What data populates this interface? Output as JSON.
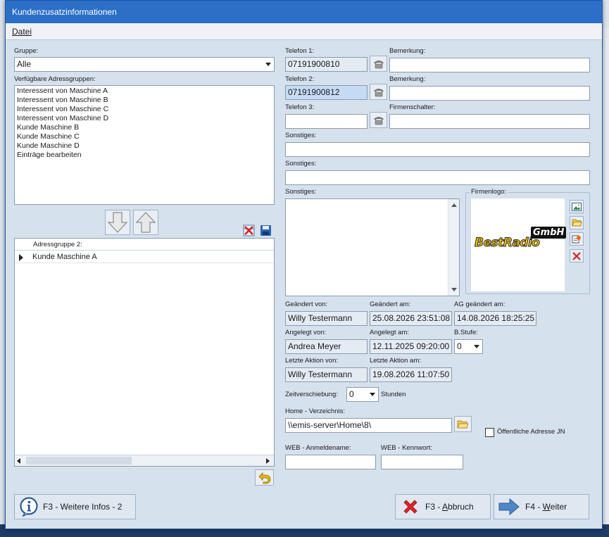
{
  "window": {
    "title": "Kundenzusatzinformationen"
  },
  "menu": {
    "datei": "Datei"
  },
  "left": {
    "gruppe_label": "Gruppe:",
    "gruppe_value": "Alle",
    "verfuegbar_label": "Verfügbare Adressgruppen:",
    "groups": [
      "Interessent von Maschine A",
      "Interessent von Maschine B",
      "Interessent von Maschine C",
      "Interessent von Maschine D",
      "Kunde Maschine B",
      "Kunde Maschine C",
      "Kunde Maschine D",
      "Einträge bearbeiten"
    ],
    "grid_header": "Adressgruppe 2:",
    "grid_rows": [
      "Kunde Maschine A"
    ]
  },
  "right": {
    "telefon1_label": "Telefon 1:",
    "telefon1_value": "07191900810",
    "telefon2_label": "Telefon 2:",
    "telefon2_value": "07191900812",
    "telefon3_label": "Telefon 3:",
    "telefon3_value": "",
    "bemerkung1_label": "Bemerkung:",
    "bemerkung2_label": "Bemerkung:",
    "firmenschalter_label": "Firmenschalter:",
    "sonstiges1_label": "Sonstiges:",
    "sonstiges2_label": "Sonstiges:",
    "sonstiges3_label": "Sonstiges:",
    "firmenlogo_label": "Firmenlogo:",
    "logo_text_main": "BestRadio",
    "logo_text_badge": "GmbH",
    "geaendert_von_label": "Geändert von:",
    "geaendert_von_value": "Willy Testermann",
    "geaendert_am_label": "Geändert am:",
    "geaendert_am_value": "25.08.2026 23:51:08",
    "ag_geaendert_label": "AG geändert am:",
    "ag_geaendert_value": "14.08.2026 18:25:25",
    "angelegt_von_label": "Angelegt von:",
    "angelegt_von_value": "Andrea Meyer",
    "angelegt_am_label": "Angelegt am:",
    "angelegt_am_value": "12.11.2025 09:20:00",
    "bstufe_label": "B.Stufe:",
    "bstufe_value": "0",
    "letzte_aktion_von_label": "Letzte Aktion von:",
    "letzte_aktion_von_value": "Willy Testermann",
    "letzte_aktion_am_label": "Letzte Aktion am:",
    "letzte_aktion_am_value": "19.08.2026 11:07:50",
    "zeitverschiebung_label": "Zeitverschiebung:",
    "zeitverschiebung_value": "0",
    "stunden_label": "Stunden",
    "home_label": "Home - Verzeichnis:",
    "home_value": "\\\\emis-server\\Home\\8\\",
    "oeffentlich_label": "Öffentliche Adresse JN",
    "web_anmeldename_label": "WEB - Anmeldename:",
    "web_kennwort_label": "WEB - Kennwort:"
  },
  "buttons": {
    "weitere_infos": "F3 - Weitere Infos - 2",
    "abbruch_prefix": "F3 - ",
    "abbruch_underlined": "A",
    "abbruch_rest": "bbruch",
    "weiter_prefix": "F4 - ",
    "weiter_underlined": "W",
    "weiter_rest": "eiter"
  },
  "colors": {
    "titlebar": "#2b6fc7",
    "dialog_bg": "#d6e1ee",
    "logo_yellow": "#f5c400"
  }
}
